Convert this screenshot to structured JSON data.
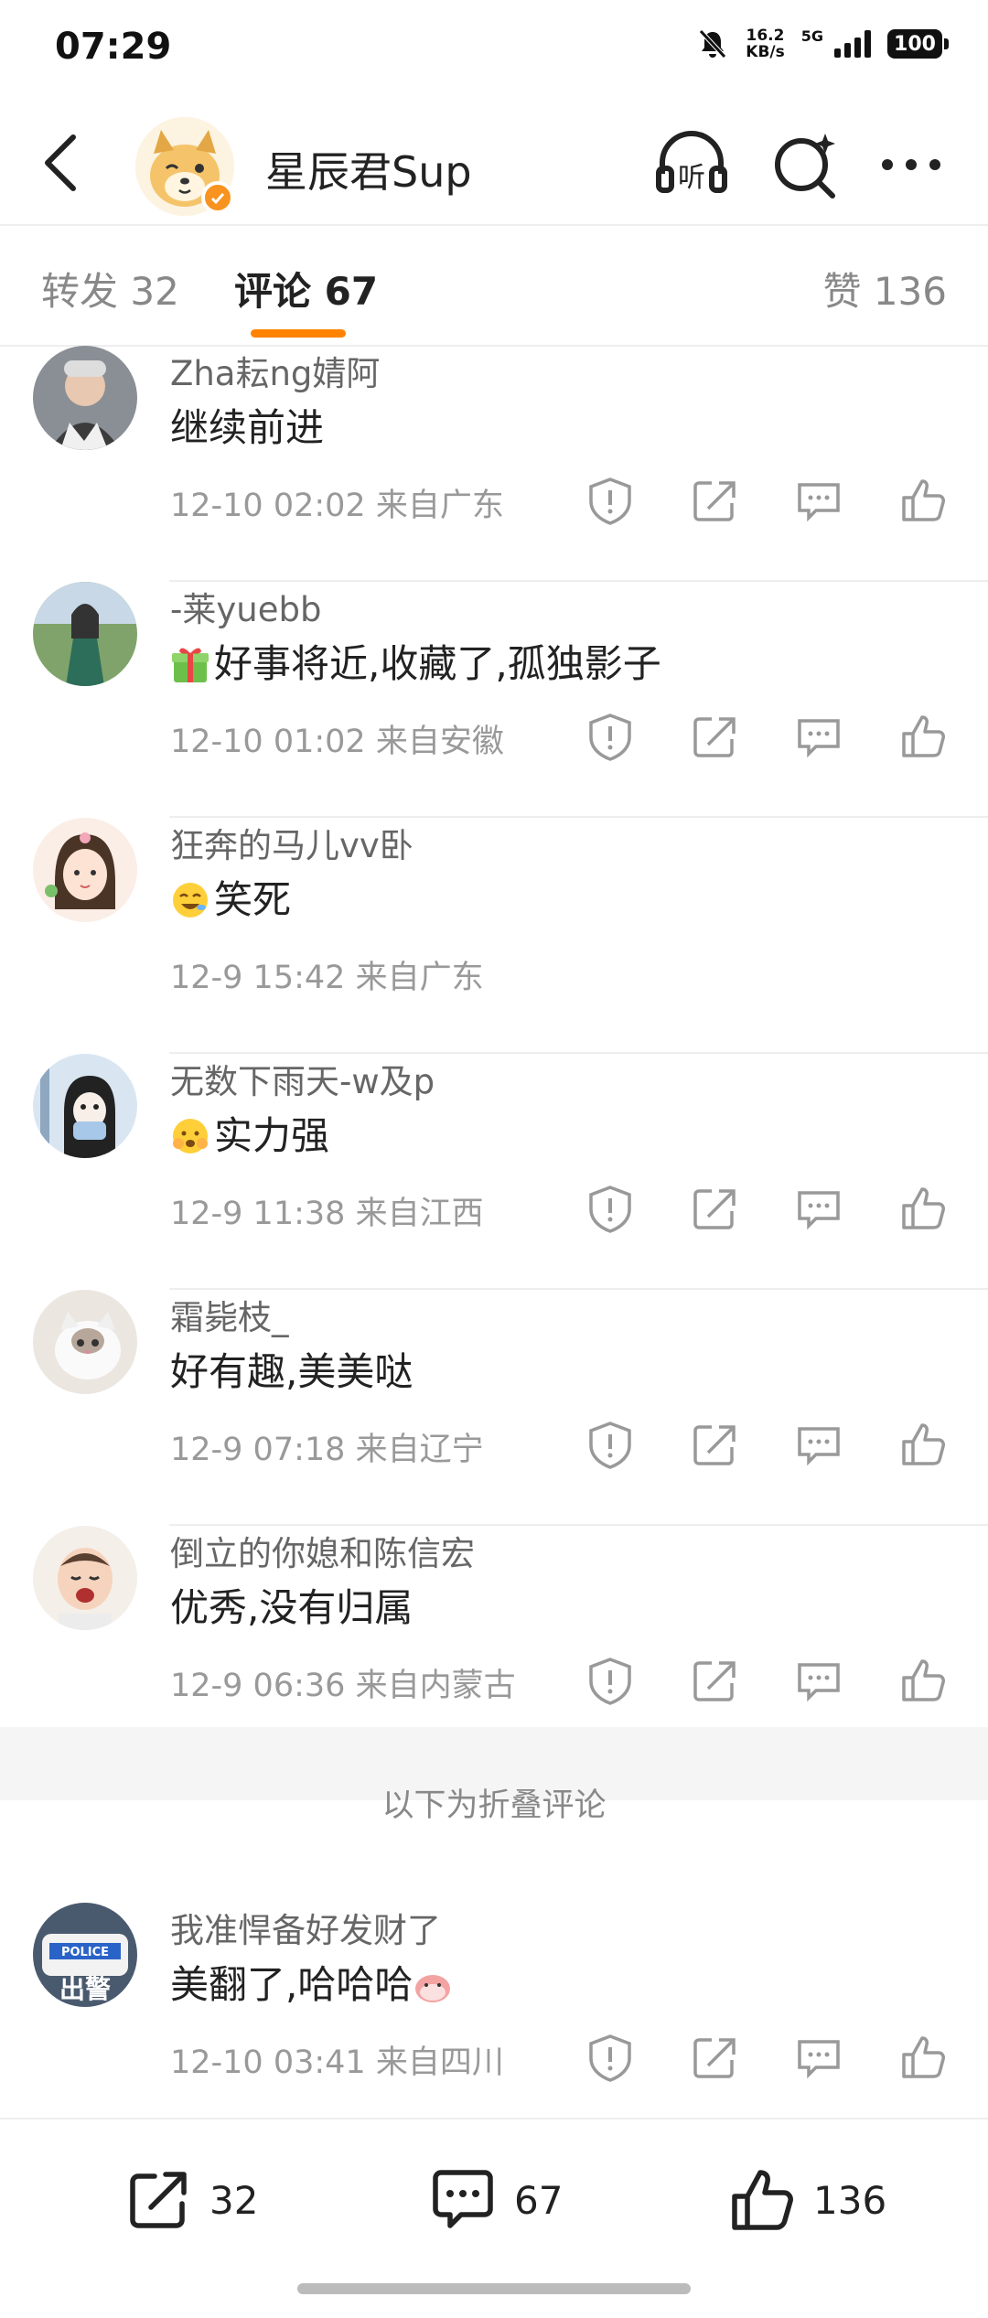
{
  "status_bar": {
    "time": "07:29",
    "net_speed_top": "16.2",
    "net_speed_unit": "KB/s",
    "signal_label": "5G",
    "battery": "100"
  },
  "header": {
    "title": "星辰君Sup",
    "listen_label": "听"
  },
  "tabs": {
    "repost": "转发 32",
    "comments": "评论 67",
    "likes": "赞 136"
  },
  "comments": [
    {
      "name": "Zha耘ng婧阿",
      "text": "继续前进",
      "time": "12-10 02:02",
      "location": "来自广东",
      "emoji": ""
    },
    {
      "name": "-莱yuebb",
      "text": "好事将近,收藏了,孤独影子",
      "time": "12-10 01:02",
      "location": "来自安徽",
      "emoji": "gift-emoji"
    },
    {
      "name": "狂奔的马儿vv卧",
      "text": "笑死",
      "time": "12-9 15:42",
      "location": "来自广东",
      "emoji": "laugh-emoji"
    },
    {
      "name": "无数下雨天-w及p",
      "text": "实力强",
      "time": "12-9 11:38",
      "location": "来自江西",
      "emoji": "shy-emoji"
    },
    {
      "name": "霜毙枝_",
      "text": "好有趣,美美哒",
      "time": "12-9 07:18",
      "location": "来自辽宁",
      "emoji": ""
    },
    {
      "name": "倒立的你媳和陈信宏",
      "text": "优秀,没有归属",
      "time": "12-9 06:36",
      "location": "来自内蒙古",
      "emoji": ""
    }
  ],
  "fold_label": "以下为折叠评论",
  "folded_comment": {
    "name": "我准悍备好发财了",
    "text": "美翻了,哈哈哈",
    "time": "12-10 03:41",
    "location": "来自四川",
    "avatar_text": "出警",
    "avatar_sign": "POLICE"
  },
  "bottom_bar": {
    "repost_count": "32",
    "comment_count": "67",
    "like_count": "136"
  },
  "colors": {
    "accent": "#ff8200",
    "verified": "#f7931e"
  }
}
